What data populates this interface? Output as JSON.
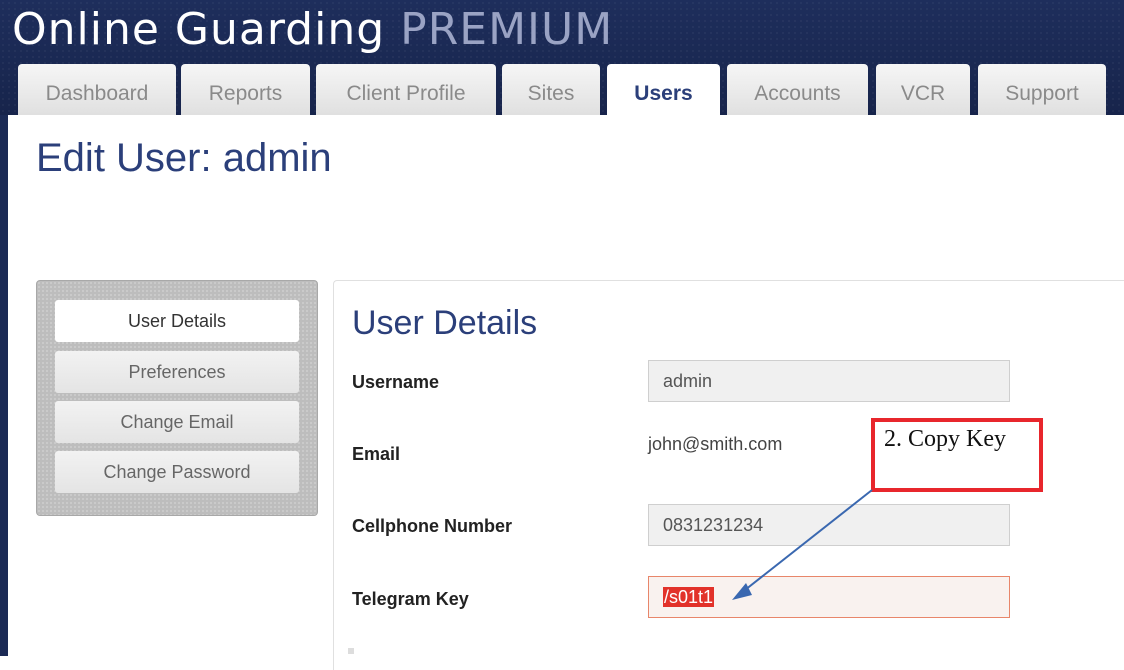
{
  "app": {
    "brand_main": "Online Guarding",
    "brand_sub": "PREMIUM"
  },
  "tabs": [
    {
      "label": "Dashboard",
      "active": false
    },
    {
      "label": "Reports",
      "active": false
    },
    {
      "label": "Client Profile",
      "active": false
    },
    {
      "label": "Sites",
      "active": false
    },
    {
      "label": "Users",
      "active": true
    },
    {
      "label": "Accounts",
      "active": false
    },
    {
      "label": "VCR",
      "active": false
    },
    {
      "label": "Support",
      "active": false
    }
  ],
  "page": {
    "title": "Edit User: admin"
  },
  "sidebar": {
    "items": [
      {
        "label": "User Details",
        "active": true
      },
      {
        "label": "Preferences",
        "active": false
      },
      {
        "label": "Change Email",
        "active": false
      },
      {
        "label": "Change Password",
        "active": false
      }
    ]
  },
  "user_details": {
    "heading": "User Details",
    "username_label": "Username",
    "username_value": "admin",
    "email_label": "Email",
    "email_value": "john@smith.com",
    "cellphone_label": "Cellphone Number",
    "cellphone_value": "0831231234",
    "telegram_label": "Telegram Key",
    "telegram_value": "/s01t1"
  },
  "annotation": {
    "text": "2. Copy Key",
    "box_color": "#e8262c",
    "arrow_color": "#3a68b0"
  },
  "colors": {
    "header_bg": "#1b2a55",
    "title_blue": "#2b3f7a",
    "selection_red": "#e2322a"
  }
}
